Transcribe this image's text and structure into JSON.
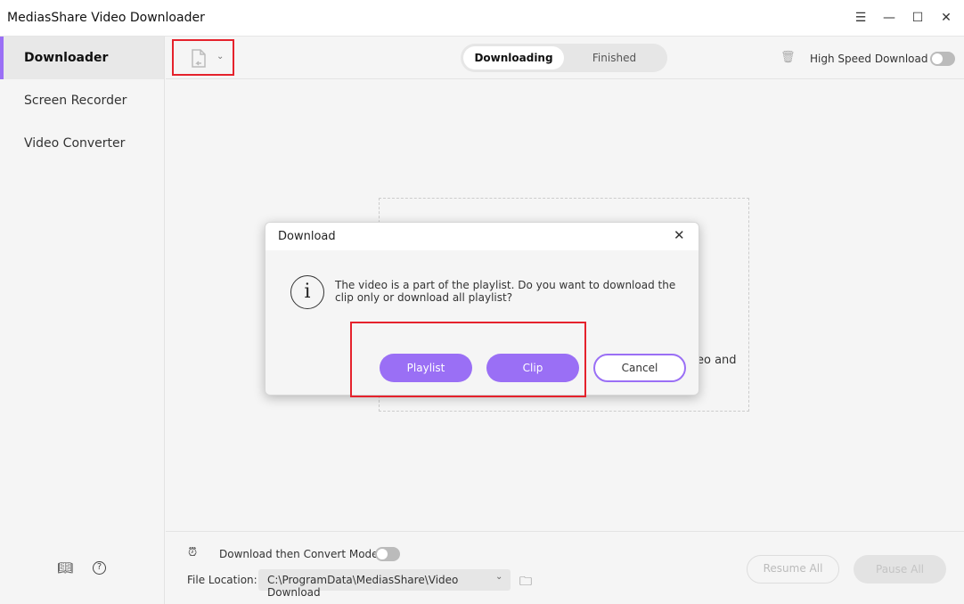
{
  "app": {
    "title": "MediasShare Video Downloader"
  },
  "window": {
    "menu_icon": "menu-icon",
    "minimize_icon": "minimize-icon",
    "maximize_icon": "maximize-icon",
    "close_icon": "close-icon"
  },
  "sidebar": {
    "items": [
      {
        "label": "Downloader",
        "active": true
      },
      {
        "label": "Screen Recorder"
      },
      {
        "label": "Video Converter"
      }
    ]
  },
  "toolbar": {
    "tabs": [
      {
        "label": "Downloading",
        "active": true
      },
      {
        "label": "Finished"
      }
    ],
    "high_speed_label": "High Speed Download",
    "high_speed_on": false
  },
  "dropzone": {
    "partial_text": "eo and"
  },
  "dialog": {
    "title": "Download",
    "message": "The video is a part of the playlist. Do you want to download the clip only or download all playlist?",
    "buttons": {
      "playlist": "Playlist",
      "clip": "Clip",
      "cancel": "Cancel"
    }
  },
  "bottom": {
    "convert_mode_label": "Download then Convert Mode",
    "convert_mode_on": false,
    "file_location_label": "File Location:",
    "file_location_value": "C:\\ProgramData\\MediasShare\\Video Download",
    "resume_all": "Resume All",
    "pause_all": "Pause All"
  },
  "colors": {
    "accent": "#9a6ff5",
    "highlight": "#e5222c"
  }
}
